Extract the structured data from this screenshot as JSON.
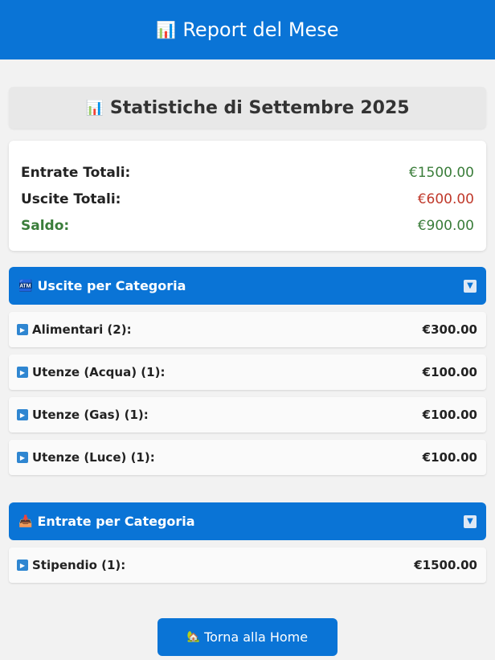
{
  "header": {
    "icon": "bar-chart-icon",
    "title": "Report del Mese"
  },
  "stats": {
    "icon": "bar-chart-icon",
    "title": "Statistiche di Settembre 2025"
  },
  "summary": {
    "income_label": "Entrate Totali:",
    "income_value": "€1500.00",
    "expense_label": "Uscite Totali:",
    "expense_value": "€600.00",
    "balance_label": "Saldo:",
    "balance_value": "€900.00",
    "colors": {
      "positive": "#3a7d3a",
      "negative": "#c0392b",
      "accent": "#0a74d6"
    }
  },
  "expenses": {
    "icon": "atm-icon",
    "title": "Uscite per Categoria",
    "items": [
      {
        "label": "Alimentari (2):",
        "amount": "€300.00"
      },
      {
        "label": "Utenze (Acqua) (1):",
        "amount": "€100.00"
      },
      {
        "label": "Utenze (Gas) (1):",
        "amount": "€100.00"
      },
      {
        "label": "Utenze (Luce) (1):",
        "amount": "€100.00"
      }
    ]
  },
  "incomes": {
    "icon": "inbox-tray-icon",
    "title": "Entrate per Categoria",
    "items": [
      {
        "label": "Stipendio (1):",
        "amount": "€1500.00"
      }
    ]
  },
  "home_button": {
    "icon": "house-icon",
    "label": "Torna alla Home"
  }
}
